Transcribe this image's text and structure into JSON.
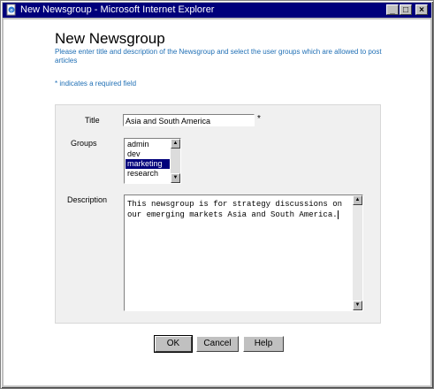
{
  "window": {
    "title": "New Newsgroup - Microsoft Internet Explorer"
  },
  "page": {
    "heading": "New Newsgroup",
    "instructions": "Please enter title and description of the Newsgroup and select the user groups which are allowed to post articles",
    "required_note": "* indicates a required field"
  },
  "form": {
    "title_label": "Title",
    "title_value": "Asia and South America",
    "required_marker": "*",
    "groups_label": "Groups",
    "groups": [
      "admin",
      "dev",
      "marketing",
      "research"
    ],
    "selected_group": "marketing",
    "description_label": "Description",
    "description_value": "This newsgroup is for strategy discussions on our emerging markets Asia and South America."
  },
  "buttons": {
    "ok": "OK",
    "cancel": "Cancel",
    "help": "Help"
  },
  "icons": {
    "window_icon": "ie-page-icon",
    "minimize": "minimize-icon",
    "maximize": "maximize-icon",
    "close": "close-icon"
  }
}
